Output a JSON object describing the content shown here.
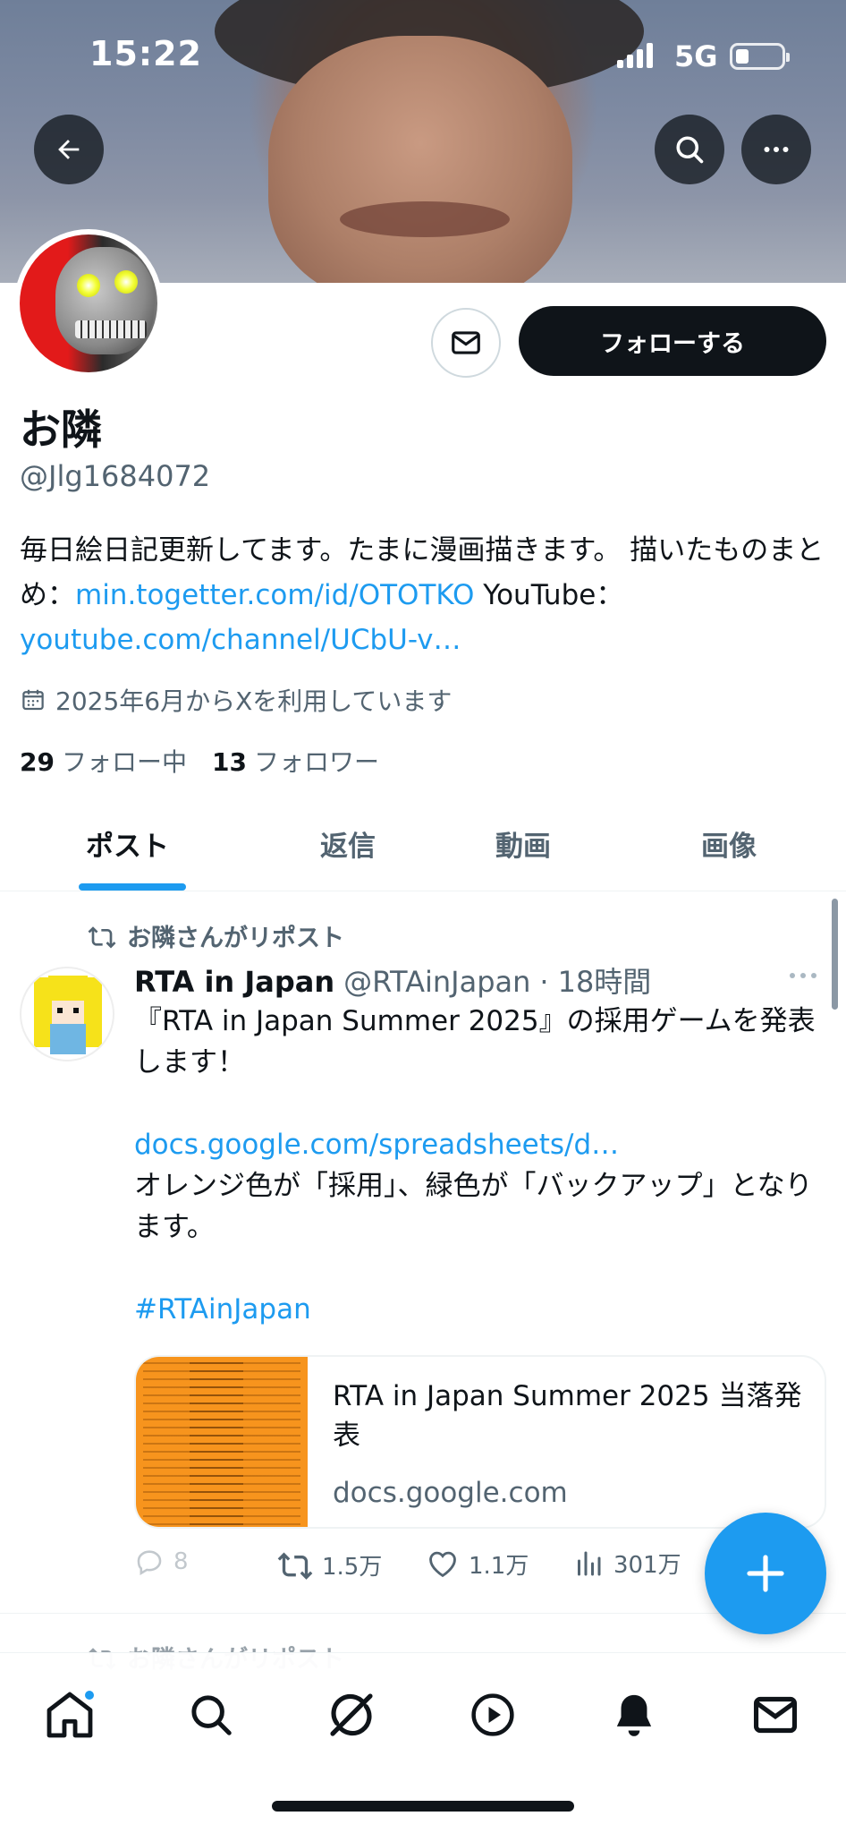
{
  "status_bar": {
    "time": "15:22",
    "network": "5G"
  },
  "profile": {
    "name": "お隣",
    "handle": "@Jlg1684072",
    "bio_text": "毎日絵日記更新してます。たまに漫画描きます。 描いたものまとめ：",
    "bio_link1": "min.togetter.com/id/OTOTKO",
    "bio_youtube": " YouTube：",
    "bio_link2": "youtube.com/channel/UCbU-v…",
    "joined": "2025年6月からXを利用しています",
    "following_count": "29",
    "following_label": "フォロー中",
    "followers_count": "13",
    "followers_label": "フォロワー",
    "follow_button": "フォローする"
  },
  "tabs": [
    {
      "label": "ポスト",
      "active": true
    },
    {
      "label": "返信",
      "active": false
    },
    {
      "label": "動画",
      "active": false
    },
    {
      "label": "画像",
      "active": false
    }
  ],
  "post": {
    "repost_label": "お隣さんがリポスト",
    "author_name": "RTA in Japan",
    "author_handle": "@RTAinJapan",
    "separator": "·",
    "time": "18時間",
    "body_line1": "『RTA in Japan Summer 2025』の採用ゲームを発表します！",
    "body_link": "docs.google.com/spreadsheets/d…",
    "body_line2": "オレンジ色が「採用」、緑色が「バックアップ」となります。",
    "hashtag": "#RTAinJapan",
    "card_title": "RTA in Japan Summer 2025 当落発表",
    "card_domain": "docs.google.com",
    "replies": "8",
    "reposts": "1.5万",
    "likes": "1.1万",
    "views": "301万"
  },
  "next_post": {
    "repost_label": "お隣さんがリポスト"
  },
  "colors": {
    "accent": "#1d9bf0",
    "text": "#0f1419",
    "muted": "#536471",
    "follow_bg": "#0f1419"
  },
  "icons": [
    "back-arrow-icon",
    "search-icon",
    "more-icon",
    "mail-icon",
    "calendar-icon",
    "repost-icon",
    "reply-icon",
    "like-icon",
    "views-icon",
    "plus-icon",
    "home-icon",
    "grok-icon",
    "play-icon",
    "bell-icon"
  ]
}
